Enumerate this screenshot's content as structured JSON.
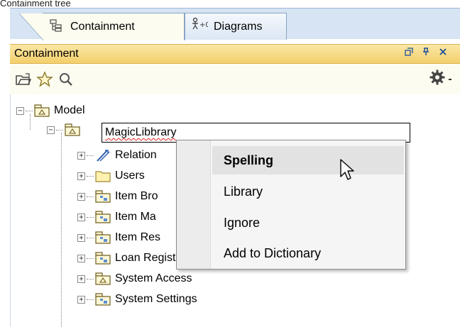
{
  "caption": "Containment tree",
  "tabs": [
    {
      "label": "Containment",
      "icon": "containment-tree-icon",
      "active": true
    },
    {
      "label": "Diagrams",
      "icon": "diagrams-icon",
      "active": false
    }
  ],
  "panel": {
    "title": "Containment",
    "buttons": [
      "restore-icon",
      "pin-icon",
      "close-icon"
    ]
  },
  "toolbar": {
    "icons": [
      "open-folder-icon",
      "star-icon",
      "search-icon",
      "gear-icon",
      "dropdown-arrow-icon"
    ]
  },
  "tree": {
    "root": {
      "label": "Model",
      "icon": "package-icon"
    },
    "edit_value": "MagicLibbrary",
    "children": [
      {
        "label": "Relations",
        "visible_text": "Relation",
        "icon": "relation-icon"
      },
      {
        "label": "Users",
        "icon": "folder-icon"
      },
      {
        "label": "Item Bro",
        "icon": "model-package-icon"
      },
      {
        "label": "Item Ma",
        "icon": "model-package-icon"
      },
      {
        "label": "Item Res",
        "icon": "model-package-icon"
      },
      {
        "label": "Loan Registration",
        "icon": "model-package-icon"
      },
      {
        "label": "System Access",
        "icon": "package-icon"
      },
      {
        "label": "System Settings",
        "icon": "model-package-icon"
      }
    ]
  },
  "context_menu": {
    "items": [
      {
        "label": "Spelling",
        "selected": true
      },
      {
        "label": "Library",
        "selected": false
      },
      {
        "label": "Ignore",
        "selected": false
      },
      {
        "label": "Add to Dictionary",
        "selected": false
      }
    ]
  },
  "colors": {
    "tab_strip": "#d6e4f3",
    "panel_header": "#f3cf6b",
    "panel_bg": "#fdfcf0",
    "spell_error": "#e02020"
  }
}
